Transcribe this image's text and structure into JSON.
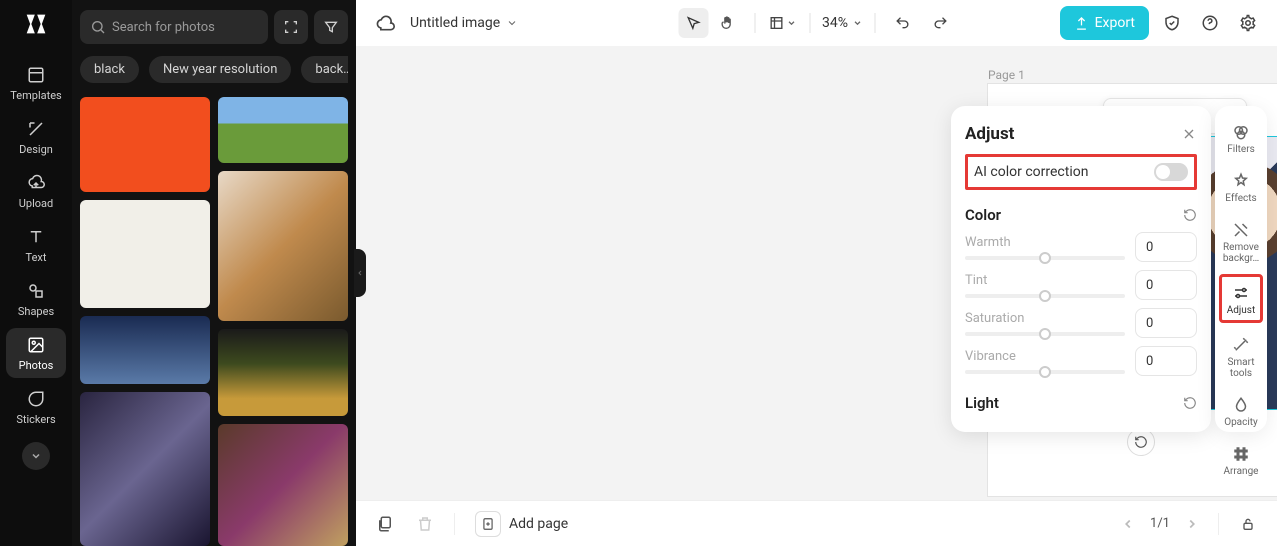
{
  "rail": {
    "items": [
      {
        "label": "Templates"
      },
      {
        "label": "Design"
      },
      {
        "label": "Upload"
      },
      {
        "label": "Text"
      },
      {
        "label": "Shapes"
      },
      {
        "label": "Photos"
      },
      {
        "label": "Stickers"
      }
    ]
  },
  "photos_panel": {
    "search_placeholder": "Search for photos",
    "chips": [
      "black",
      "New year resolution",
      "back…"
    ]
  },
  "topbar": {
    "title": "Untitled image",
    "zoom": "34%"
  },
  "export_label": "Export",
  "page_label": "Page 1",
  "adjust": {
    "title": "Adjust",
    "ai_label": "AI color correction",
    "section_color": "Color",
    "warmth": {
      "label": "Warmth",
      "value": "0"
    },
    "tint": {
      "label": "Tint",
      "value": "0"
    },
    "saturation": {
      "label": "Saturation",
      "value": "0"
    },
    "vibrance": {
      "label": "Vibrance",
      "value": "0"
    },
    "section_light": "Light"
  },
  "rrail": {
    "items": [
      {
        "label": "Filters"
      },
      {
        "label": "Effects"
      },
      {
        "label": "Remove backgr…"
      },
      {
        "label": "Adjust"
      },
      {
        "label": "Smart tools"
      },
      {
        "label": "Opacity"
      },
      {
        "label": "Arrange"
      }
    ]
  },
  "bottombar": {
    "add_page": "Add page",
    "page_indicator": "1/1"
  }
}
